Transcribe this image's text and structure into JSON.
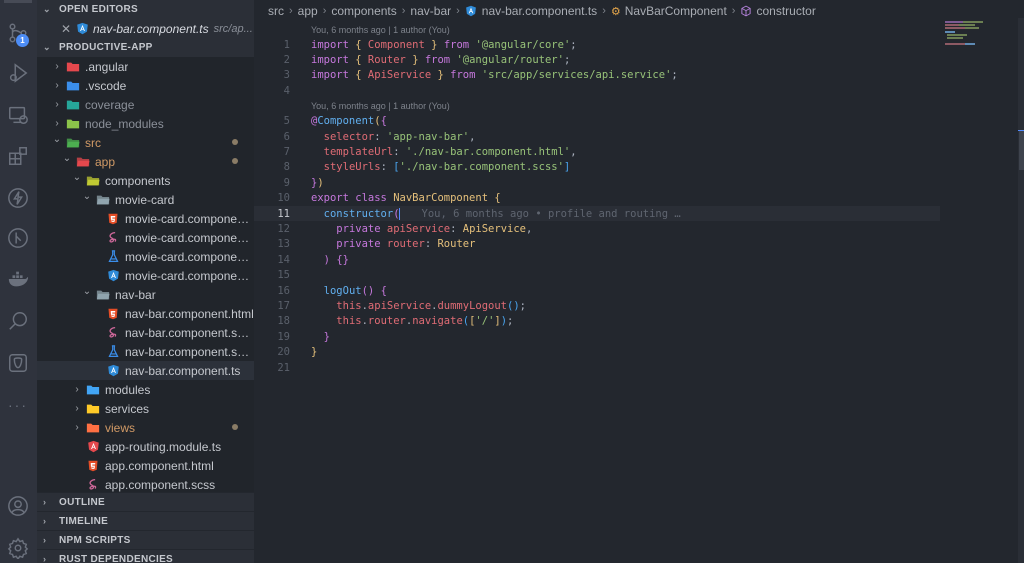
{
  "activity_bar": {
    "items": [
      {
        "name": "source-control",
        "badge": "1"
      },
      {
        "name": "run-debug"
      },
      {
        "name": "remote-explorer"
      },
      {
        "name": "extensions"
      },
      {
        "name": "thunder-client"
      },
      {
        "name": "git-graph"
      },
      {
        "name": "docker"
      },
      {
        "name": "search"
      },
      {
        "name": "postgres"
      },
      {
        "name": "more"
      }
    ],
    "bottom": [
      {
        "name": "accounts"
      },
      {
        "name": "manage"
      }
    ]
  },
  "sidebar": {
    "open_editors_title": "OPEN EDITORS",
    "open_editors": [
      {
        "file": "nav-bar.component.ts",
        "path": "src/ap..."
      }
    ],
    "project_title": "PRODUCTIVE-APP",
    "tree": [
      {
        "label": ".angular",
        "depth": 0,
        "type": "folder",
        "expanded": false,
        "icon": "angular-folder",
        "color": "#e5484d"
      },
      {
        "label": ".vscode",
        "depth": 0,
        "type": "folder",
        "expanded": false,
        "icon": "vscode-folder",
        "color": "#3b8eea"
      },
      {
        "label": "coverage",
        "depth": 0,
        "type": "folder",
        "expanded": false,
        "icon": "coverage-folder",
        "color": "#26a69a",
        "dim": true
      },
      {
        "label": "node_modules",
        "depth": 0,
        "type": "folder",
        "expanded": false,
        "icon": "node-folder",
        "color": "#8bc34a",
        "dim": true
      },
      {
        "label": "src",
        "depth": 0,
        "type": "folder",
        "expanded": true,
        "icon": "src-folder",
        "color": "#4caf50",
        "modified": true
      },
      {
        "label": "app",
        "depth": 1,
        "type": "folder",
        "expanded": true,
        "icon": "app-folder",
        "color": "#e5484d",
        "modified": true
      },
      {
        "label": "components",
        "depth": 2,
        "type": "folder",
        "expanded": true,
        "icon": "components-folder",
        "color": "#c0ca33"
      },
      {
        "label": "movie-card",
        "depth": 3,
        "type": "folder",
        "expanded": true,
        "icon": "folder",
        "color": "#90a4ae"
      },
      {
        "label": "movie-card.component.h...",
        "depth": 4,
        "type": "file",
        "icon": "html"
      },
      {
        "label": "movie-card.component.s...",
        "depth": 4,
        "type": "file",
        "icon": "sass"
      },
      {
        "label": "movie-card.component.s...",
        "depth": 4,
        "type": "file",
        "icon": "test"
      },
      {
        "label": "movie-card.component.ts",
        "depth": 4,
        "type": "file",
        "icon": "angular-component"
      },
      {
        "label": "nav-bar",
        "depth": 3,
        "type": "folder",
        "expanded": true,
        "icon": "folder",
        "color": "#90a4ae"
      },
      {
        "label": "nav-bar.component.html",
        "depth": 4,
        "type": "file",
        "icon": "html"
      },
      {
        "label": "nav-bar.component.scss",
        "depth": 4,
        "type": "file",
        "icon": "sass"
      },
      {
        "label": "nav-bar.component.spec...",
        "depth": 4,
        "type": "file",
        "icon": "test"
      },
      {
        "label": "nav-bar.component.ts",
        "depth": 4,
        "type": "file",
        "icon": "angular-component",
        "selected": true
      },
      {
        "label": "modules",
        "depth": 2,
        "type": "folder",
        "expanded": false,
        "icon": "modules-folder",
        "color": "#42a5f5"
      },
      {
        "label": "services",
        "depth": 2,
        "type": "folder",
        "expanded": false,
        "icon": "services-folder",
        "color": "#ffca28"
      },
      {
        "label": "views",
        "depth": 2,
        "type": "folder",
        "expanded": false,
        "icon": "views-folder",
        "color": "#ff7043",
        "modified": true
      },
      {
        "label": "app-routing.module.ts",
        "depth": 2,
        "type": "file",
        "icon": "angular-routing"
      },
      {
        "label": "app.component.html",
        "depth": 2,
        "type": "file",
        "icon": "html"
      },
      {
        "label": "app.component.scss",
        "depth": 2,
        "type": "file",
        "icon": "sass"
      }
    ],
    "bottom_sections": [
      "OUTLINE",
      "TIMELINE",
      "NPM SCRIPTS",
      "RUST DEPENDENCIES"
    ]
  },
  "editor": {
    "breadcrumb": [
      "src",
      "app",
      "components",
      "nav-bar",
      "nav-bar.component.ts",
      "NavBarComponent",
      "constructor"
    ],
    "codelens": "You, 6 months ago | 1 author (You)",
    "active_line": 11,
    "inline_blame": "You, 6 months ago • profile and routing …",
    "lines": [
      "import { Component } from '@angular/core';",
      "import { Router } from '@angular/router';",
      "import { ApiService } from 'src/app/services/api.service';",
      "",
      "@Component({",
      "  selector: 'app-nav-bar',",
      "  templateUrl: './nav-bar.component.html',",
      "  styleUrls: ['./nav-bar.component.scss']",
      "})",
      "export class NavBarComponent {",
      "  constructor(",
      "    private apiService: ApiService,",
      "    private router: Router",
      "  ) {}",
      "",
      "  logOut() {",
      "    this.apiService.dummyLogout();",
      "    this.router.navigate(['/']);",
      "  }",
      "}",
      ""
    ]
  },
  "colors": {
    "keyword": "#c678dd",
    "variable": "#e06c75",
    "string": "#98c379",
    "function": "#61afef",
    "class": "#e5c07b",
    "badge": "#4d8df6",
    "modified_dot": "#8a7c66"
  }
}
